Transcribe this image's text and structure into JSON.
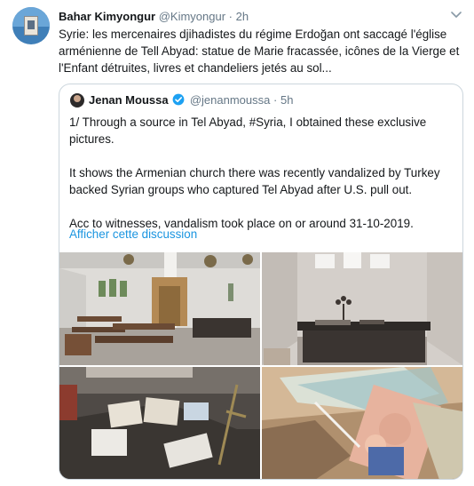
{
  "tweet": {
    "author_name": "Bahar Kimyongur",
    "author_handle": "@Kimyongur",
    "separator": "·",
    "time": "2h",
    "text": "Syrie: les mercenaires djihadistes du régime Erdoğan ont saccagé l'église arménienne de Tell Abyad: statue de Marie fracassée, icônes de la Vierge et l'Enfant détruites, livres et chandeliers jetés au sol..."
  },
  "quoted_tweet": {
    "author_name": "Jenan Moussa",
    "author_handle": "@jenanmoussa",
    "separator": "·",
    "time": "5h",
    "paragraphs": [
      "1/ Through a source in Tel Abyad, #Syria, I obtained these exclusive pictures.",
      "It shows the Armenian church there was recently vandalized by Turkey backed Syrian groups who captured Tel Abyad after U.S. pull out.",
      "Acc to witnesses, vandalism took place on or around 31-10-2019."
    ],
    "show_thread": "Afficher cette discussion"
  },
  "colors": {
    "link": "#1b95e0",
    "verified": "#1da1f2",
    "secondary_text": "#657786",
    "border": "#ccd6dd"
  },
  "icons": {
    "caret": "chevron-down-icon",
    "verified": "verified-badge-icon"
  }
}
